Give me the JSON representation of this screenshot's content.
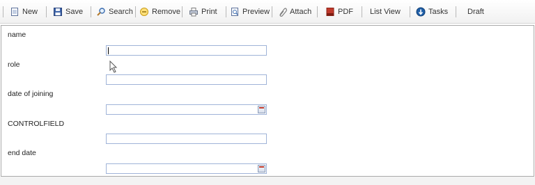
{
  "toolbar": {
    "new": "New",
    "save": "Save",
    "search": "Search",
    "remove": "Remove",
    "print": "Print",
    "preview": "Preview",
    "attach": "Attach",
    "pdf": "PDF",
    "list_view": "List View",
    "tasks": "Tasks",
    "draft": "Draft"
  },
  "icons": {
    "new": "document-icon",
    "save": "floppy-disk-icon",
    "search": "magnifier-icon",
    "remove": "remove-circle-icon",
    "print": "printer-icon",
    "preview": "preview-icon",
    "attach": "paperclip-icon",
    "pdf": "pdf-icon",
    "tasks": "tasks-icon",
    "calendar": "calendar-icon"
  },
  "form": {
    "fields": [
      {
        "label": "name",
        "value": ""
      },
      {
        "label": "role",
        "value": ""
      },
      {
        "label": "date of joining",
        "value": ""
      },
      {
        "label": "CONTROLFIELD",
        "value": ""
      },
      {
        "label": "end date",
        "value": ""
      }
    ]
  },
  "colors": {
    "field_border": "#9fb3d8",
    "form_border": "#a9a9a9",
    "pdf_red": "#c0392b",
    "tasks_blue": "#1f5fa8"
  }
}
